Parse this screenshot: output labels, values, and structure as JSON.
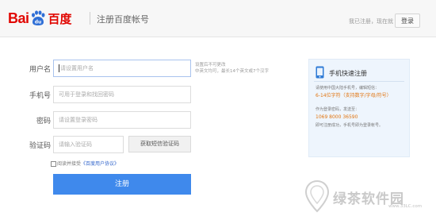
{
  "header": {
    "logo_latin": "Bai",
    "logo_paw_text": "du",
    "logo_chinese": "百度",
    "page_title": "注册百度帐号",
    "login_prompt": "我已注册，现在就",
    "login_button": "登录"
  },
  "form": {
    "username": {
      "label": "用户名",
      "placeholder": "请设置用户名",
      "hint_line1": "设置后不可更改",
      "hint_line2": "中英文均可，最长14个英文或7个汉字"
    },
    "phone": {
      "label": "手机号",
      "placeholder": "可用于登录和找回密码"
    },
    "password": {
      "label": "密码",
      "placeholder": "请设置登录密码"
    },
    "code": {
      "label": "验证码",
      "placeholder": "请输入验证码",
      "sms_button": "获取短信验证码"
    },
    "agreement": {
      "text": "阅读并接受",
      "link": "《百度用户协议》"
    },
    "register_button": "注册"
  },
  "side_panel": {
    "title": "手机快速注册",
    "lines": [
      {
        "text": "请使用中国大陆手机号，编辑短信：",
        "style": "gray"
      },
      {
        "text": "6-14位字符（支持数字/字母/符号）",
        "style": "orange"
      },
      {
        "text": "作为登录密码，发送至：",
        "style": "gray"
      },
      {
        "text": "1069 8000 36590",
        "style": "orange"
      },
      {
        "text": "即可注册成功，手机号即为登录帐号。",
        "style": "gray"
      }
    ]
  },
  "watermark": {
    "text": "绿茶软件园",
    "url": "www.33LC.com"
  },
  "colors": {
    "brand_red": "#e10601",
    "brand_blue": "#2f6fd6",
    "button_blue": "#3f89ec",
    "orange_text": "#e1740f"
  }
}
